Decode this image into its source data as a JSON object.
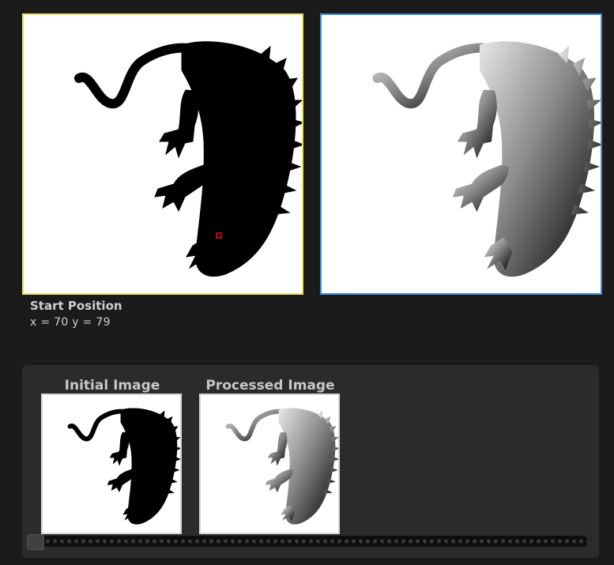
{
  "viewer": {
    "left_image": "start-position-image",
    "right_image": "processed-distance-image"
  },
  "start_position": {
    "title": "Start Position",
    "coords_text": "x = 70 y = 79"
  },
  "gallery": {
    "initial_label": "Initial Image",
    "processed_label": "Processed Image"
  },
  "colors": {
    "background": "#1b1b1b",
    "left_frame": "#e8e26a",
    "right_frame": "#3f8fd8",
    "marker": "#ff0000"
  }
}
